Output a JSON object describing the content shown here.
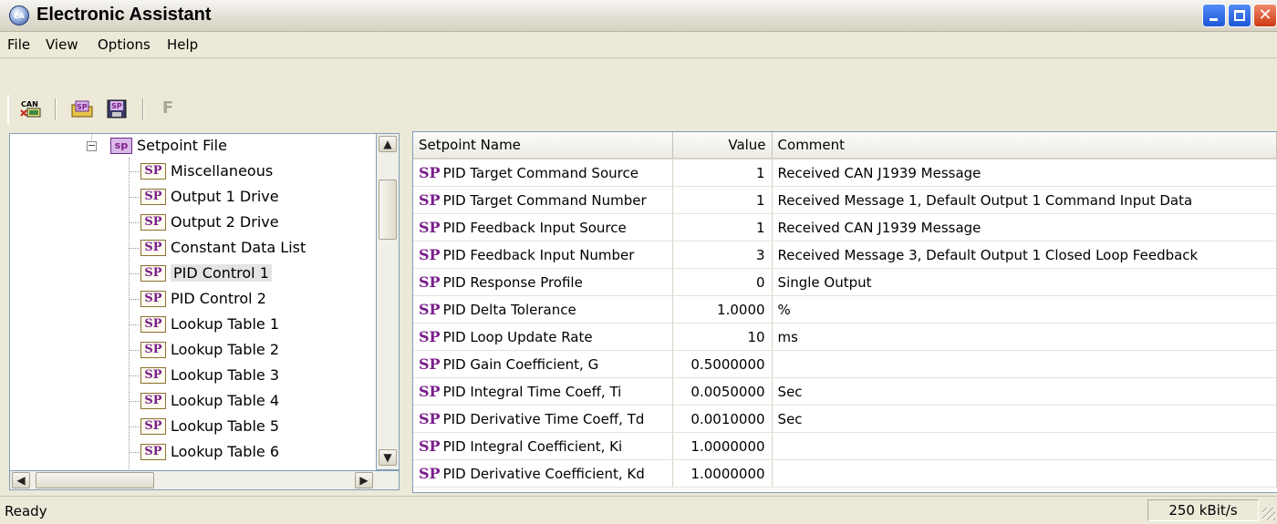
{
  "window": {
    "title": "Electronic Assistant"
  },
  "menu": [
    "File",
    "View",
    "Options",
    "Help"
  ],
  "toolbar": {
    "buttons": [
      "can-connect-icon",
      "open-setpoint-icon",
      "save-setpoint-icon",
      "flash-icon"
    ],
    "f_label": "F"
  },
  "tree": {
    "root": {
      "label": "Setpoint File",
      "icon_text": "sp"
    },
    "icon_text": "SP",
    "items": [
      "Miscellaneous",
      "Output 1 Drive",
      "Output 2 Drive",
      "Constant Data List",
      "PID Control 1",
      "PID Control 2",
      "Lookup Table 1",
      "Lookup Table 2",
      "Lookup Table 3",
      "Lookup Table 4",
      "Lookup Table 5",
      "Lookup Table 6"
    ],
    "selected": "PID Control 1"
  },
  "table": {
    "columns": [
      "Setpoint Name",
      "Value",
      "Comment"
    ],
    "row_icon": "SP",
    "rows": [
      [
        "PID Target Command Source",
        "1",
        "Received CAN J1939 Message"
      ],
      [
        "PID Target Command Number",
        "1",
        "Received Message 1, Default Output 1 Command Input Data"
      ],
      [
        "PID Feedback Input Source",
        "1",
        "Received CAN J1939 Message"
      ],
      [
        "PID Feedback Input Number",
        "3",
        "Received Message 3, Default Output 1 Closed Loop Feedback"
      ],
      [
        "PID Response Profile",
        "0",
        "Single Output"
      ],
      [
        "PID Delta Tolerance",
        "1.0000",
        "%"
      ],
      [
        "PID Loop Update Rate",
        "10",
        "ms"
      ],
      [
        "PID Gain Coefficient, G",
        "0.5000000",
        ""
      ],
      [
        "PID Integral Time Coeff, Ti",
        "0.0050000",
        "Sec"
      ],
      [
        "PID Derivative Time Coeff, Td",
        "0.0010000",
        "Sec"
      ],
      [
        "PID Integral Coefficient, Ki",
        "1.0000000",
        ""
      ],
      [
        "PID Derivative Coefficient, Kd",
        "1.0000000",
        ""
      ]
    ]
  },
  "status": {
    "text": "Ready",
    "baud": "250 kBit/s"
  }
}
